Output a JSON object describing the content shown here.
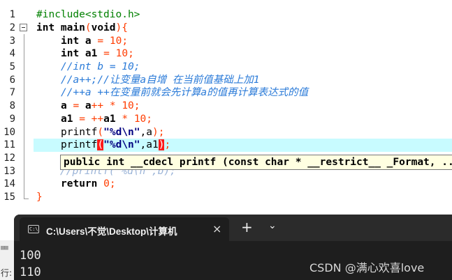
{
  "editor": {
    "line_numbers": [
      "1",
      "2",
      "3",
      "4",
      "5",
      "6",
      "7",
      "8",
      "9",
      "10",
      "11",
      "12",
      "13",
      "14",
      "15"
    ],
    "lines": {
      "l1": "#include<stdio.h>",
      "l2_kw1": "int",
      "l2_name": " main",
      "l2_p1": "(",
      "l2_kw2": "void",
      "l2_p2": "){",
      "l3_kw": "int",
      "l3_a": " a ",
      "l3_eq": "=",
      "l3_sp": " ",
      "l3_num": "10",
      "l3_semi": ";",
      "l4_kw": "int",
      "l4_a": " a1 ",
      "l4_eq": "=",
      "l4_sp": " ",
      "l4_num": "10",
      "l4_semi": ";",
      "l5": "//int b = 10;",
      "l6": "//a++;//让变量a自增 在当前值基础上加1",
      "l7": "//++a ++在变量前就会先计算a的值再计算表达式的值",
      "l8_a": "a ",
      "l8_eq": "=",
      "l8_b": " a",
      "l8_op": "++ *",
      "l8_sp": " ",
      "l8_num": "10",
      "l8_semi": ";",
      "l9_a": "a1 ",
      "l9_eq": "=",
      "l9_sp": " ",
      "l9_op": "++",
      "l9_b": "a1 ",
      "l9_op2": "*",
      "l9_sp2": " ",
      "l9_num": "10",
      "l9_semi": ";",
      "l10_fn": "printf",
      "l10_p1": "(",
      "l10_str": "\"%d\\n\"",
      "l10_rest": ",a",
      "l10_p2": ");",
      "l11_fn": "printf",
      "l11_p1": "(",
      "l11_str": "\"%d\\n\"",
      "l11_rest": ",a1",
      "l11_p2": ")",
      "l11_semi": ";",
      "l13": "//printf(\"%d\\n\",b);",
      "l14_kw": "return",
      "l14_sp": " ",
      "l14_num": "0",
      "l14_semi": ";",
      "l15": "}"
    },
    "tooltip": "public int __cdecl printf (const char * __restrict__ _Format, ..."
  },
  "terminal": {
    "tab_title": "C:\\Users\\不觉\\Desktop\\计算机",
    "tab_icon_text": "C:\\",
    "close_icon": "×",
    "new_tab_icon": "+",
    "dropdown_icon": "⌄",
    "output": [
      "100",
      "110"
    ]
  },
  "side": {
    "label": "行:"
  },
  "watermark": "CSDN @满心欢喜love"
}
